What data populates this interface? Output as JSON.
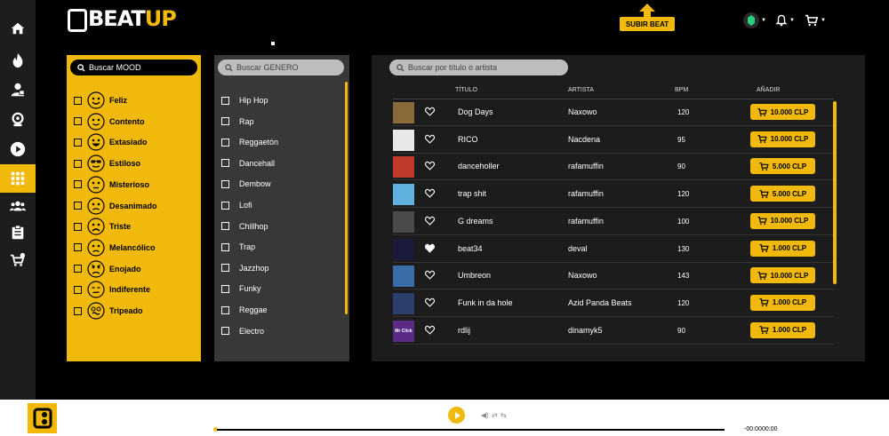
{
  "brand": {
    "logo_text_beat": "BEAT",
    "logo_text_up": "UP",
    "accent": "#f0b90b"
  },
  "header": {
    "upload_label": "SUBIR BEAT",
    "icons": [
      "gem-icon",
      "bell-icon",
      "cart-icon"
    ]
  },
  "sidebar": {
    "items": [
      {
        "name": "home-icon",
        "active": false
      },
      {
        "name": "fire-icon",
        "active": false
      },
      {
        "name": "producer-icon",
        "active": false
      },
      {
        "name": "webcam-icon",
        "active": false
      },
      {
        "name": "play-icon",
        "active": false
      },
      {
        "name": "grid-icon",
        "active": true
      },
      {
        "name": "users-icon",
        "active": false
      },
      {
        "name": "clipboard-icon",
        "active": false
      },
      {
        "name": "cart-settings-icon",
        "active": false
      }
    ]
  },
  "mood": {
    "search_placeholder": "Buscar MOOD",
    "items": [
      {
        "label": "Feliz",
        "face": "happy"
      },
      {
        "label": "Contento",
        "face": "content"
      },
      {
        "label": "Extasiado",
        "face": "ecstatic"
      },
      {
        "label": "Estiloso",
        "face": "cool"
      },
      {
        "label": "Misterioso",
        "face": "mysterious"
      },
      {
        "label": "Desanimado",
        "face": "discouraged"
      },
      {
        "label": "Triste",
        "face": "sad"
      },
      {
        "label": "Melancólico",
        "face": "melancholic"
      },
      {
        "label": "Enojado",
        "face": "angry"
      },
      {
        "label": "Indiferente",
        "face": "indifferent"
      },
      {
        "label": "Tripeado",
        "face": "trippy"
      }
    ]
  },
  "genre": {
    "search_placeholder": "Buscar GENERO",
    "items": [
      "Hip Hop",
      "Rap",
      "Reggaetón",
      "Dancehall",
      "Dembow",
      "Lofi",
      "Chillhop",
      "Trap",
      "Jazzhop",
      "Funky",
      "Reggae",
      "Electro"
    ]
  },
  "tracks": {
    "search_placeholder": "Buscar por título o artista",
    "columns": {
      "title": "TÍTULO",
      "artist": "ARTISTA",
      "bpm": "BPM",
      "add": "AÑADIR"
    },
    "rows": [
      {
        "title": "Dog Days",
        "artist": "Naxowo",
        "bpm": "120",
        "price": "10.000 CLP",
        "liked": false,
        "thumb_color": "#8a6a3a"
      },
      {
        "title": "RICO",
        "artist": "Nacdena",
        "bpm": "95",
        "price": "10.000 CLP",
        "liked": false,
        "thumb_color": "#e8e8e8"
      },
      {
        "title": "danceholler",
        "artist": "rafamuffin",
        "bpm": "90",
        "price": "5.000 CLP",
        "liked": false,
        "thumb_color": "#c0392b"
      },
      {
        "title": "trap shit",
        "artist": "rafamuffin",
        "bpm": "120",
        "price": "5.000 CLP",
        "liked": false,
        "thumb_color": "#5fb2e0"
      },
      {
        "title": "G dreams",
        "artist": "rafamuffin",
        "bpm": "100",
        "price": "10.000 CLP",
        "liked": false,
        "thumb_color": "#4a4a4a"
      },
      {
        "title": "beat34",
        "artist": "deval",
        "bpm": "130",
        "price": "1.000 CLP",
        "liked": true,
        "thumb_color": "#1a1a3a"
      },
      {
        "title": "Umbreon",
        "artist": "Naxowo",
        "bpm": "143",
        "price": "10.000 CLP",
        "liked": false,
        "thumb_color": "#3b6ea8"
      },
      {
        "title": "Funk in da hole",
        "artist": "Azid Panda Beats",
        "bpm": "120",
        "price": "1.000 CLP",
        "liked": false,
        "thumb_color": "#2c3e6b"
      },
      {
        "title": "rdlij",
        "artist": "dinamyk5",
        "bpm": "90",
        "price": "1.000 CLP",
        "liked": false,
        "thumb_color": "#5b2a86",
        "thumb_text": "Mr Click"
      }
    ]
  },
  "player": {
    "time_current": "-00:00",
    "time_total": "00:00"
  }
}
